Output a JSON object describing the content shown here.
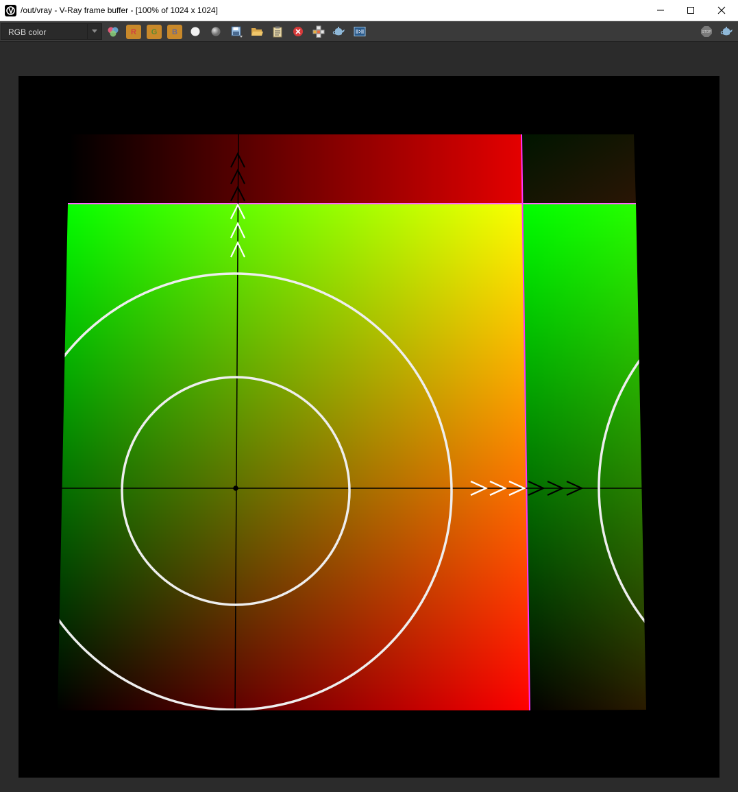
{
  "window": {
    "title": "/out/vray - V-Ray frame buffer - [100% of 1024 x 1024]"
  },
  "toolbar": {
    "channel_value": "RGB color",
    "red_channel_label": "R",
    "green_channel_label": "G",
    "blue_channel_label": "B",
    "stop_label": "STOP"
  },
  "colors": {
    "toolbar_bg": "#3a3a3a",
    "viewport_bg": "#2b2b2b",
    "channel_button": "#c9892a"
  }
}
